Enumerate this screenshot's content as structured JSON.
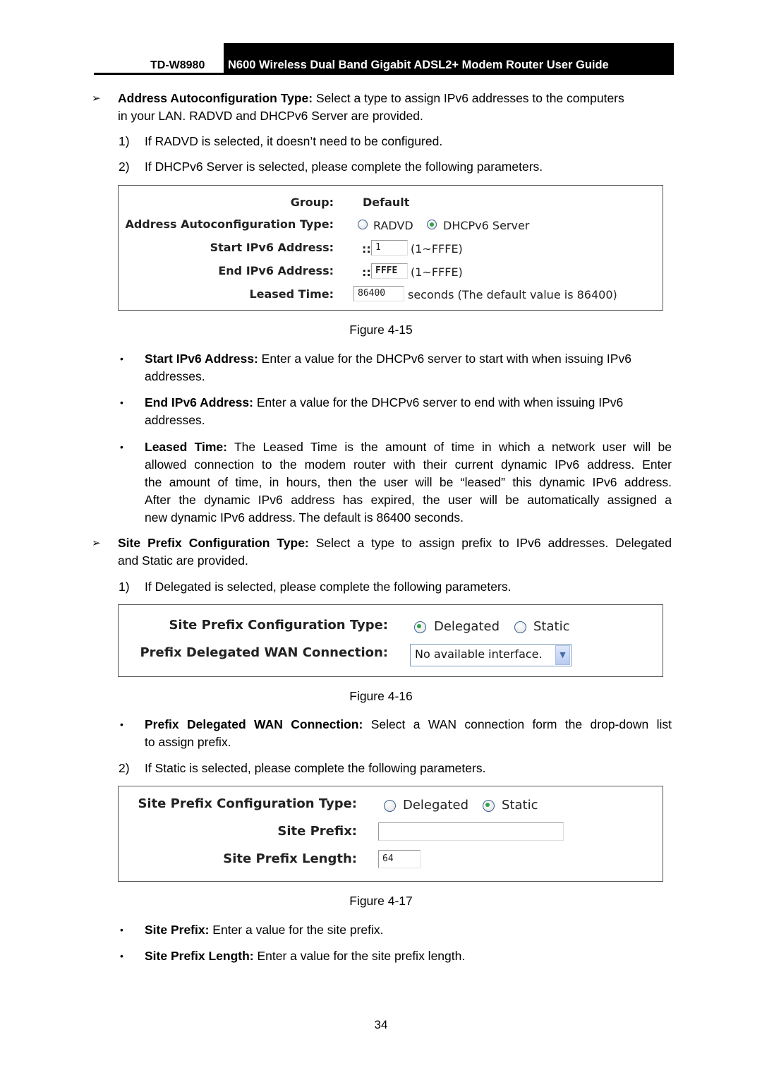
{
  "header": {
    "model": "TD-W8980",
    "title": "N600 Wireless Dual Band Gigabit ADSL2+ Modem Router User Guide"
  },
  "icons": {
    "arrow": "➢",
    "bullet": "•",
    "dropdown": "chevron-down-icon"
  },
  "sections": {
    "addr_autoconf": {
      "term": "Address Autoconfiguration Type:",
      "desc_line1": " Select a type to assign IPv6 addresses to the computers",
      "desc_line2": "in your LAN. RADVD and DHCPv6 Server are provided.",
      "step1_num": "1)",
      "step1": "If RADVD is selected, it doesn’t need to be configured.",
      "step2_num": "2)",
      "step2": "If DHCPv6 Server is selected, please complete the following parameters."
    },
    "bullets_a": [
      {
        "term": "Start IPv6 Address:",
        "line1": " Enter a value for the DHCPv6 server to start with when issuing IPv6",
        "line2": "addresses."
      },
      {
        "term": "End IPv6 Address:",
        "line1": " Enter a value for the DHCPv6 server to end with when issuing IPv6",
        "line2": "addresses."
      },
      {
        "term": "Leased Time:",
        "line1": " The Leased Time is the amount of time in which a network user will be",
        "line2": "allowed connection to the modem router with their current dynamic IPv6 address. Enter",
        "line3": "the amount of time, in hours, then the user will be “leased” this dynamic IPv6 address.",
        "line4": "After the dynamic IPv6 address has expired, the user will be automatically assigned a",
        "line5": "new dynamic IPv6 address. The default is 86400 seconds."
      }
    ],
    "site_prefix": {
      "term": "Site Prefix Configuration Type:",
      "desc_line1": " Select a type to assign prefix to IPv6 addresses. Delegated",
      "desc_line2": "and Static are provided.",
      "step1_num": "1)",
      "step1": "If Delegated is selected, please complete the following parameters.",
      "step2_num": "2)",
      "step2": "If Static is selected, please complete the following parameters."
    },
    "bullet_b": {
      "term": "Prefix Delegated WAN Connection:",
      "line1": " Select a WAN connection form the drop-down list",
      "line2": "to assign prefix."
    },
    "bullets_c": [
      {
        "term": "Site Prefix:",
        "text": " Enter a value for the site prefix."
      },
      {
        "term": "Site Prefix Length:",
        "text": " Enter a value for the site prefix length."
      }
    ]
  },
  "figures": {
    "fig15": {
      "caption": "Figure 4-15",
      "group_label": "Group:",
      "group_value": "Default",
      "autoconf_label": "Address Autoconfiguration Type:",
      "options": [
        {
          "label": "RADVD",
          "selected": false
        },
        {
          "label": "DHCPv6 Server",
          "selected": true
        }
      ],
      "start_label": "Start IPv6 Address:",
      "start_prefix": "::",
      "start_value": "1",
      "start_hint": "(1~FFFE)",
      "end_label": "End IPv6 Address:",
      "end_prefix": "::",
      "end_value": "FFFE",
      "end_hint": "(1~FFFE)",
      "leased_label": "Leased Time:",
      "leased_value": "86400",
      "leased_hint": "seconds (The default value is 86400)"
    },
    "fig16": {
      "caption": "Figure 4-16",
      "type_label": "Site Prefix Configuration Type:",
      "options": [
        {
          "label": "Delegated",
          "selected": true
        },
        {
          "label": "Static",
          "selected": false
        }
      ],
      "wan_label": "Prefix Delegated WAN Connection:",
      "wan_selected": "No available interface."
    },
    "fig17": {
      "caption": "Figure 4-17",
      "type_label": "Site Prefix Configuration Type:",
      "options": [
        {
          "label": "Delegated",
          "selected": false
        },
        {
          "label": "Static",
          "selected": true
        }
      ],
      "prefix_label": "Site Prefix:",
      "prefix_value": "",
      "length_label": "Site Prefix Length:",
      "length_value": "64"
    }
  },
  "page_number": "34"
}
